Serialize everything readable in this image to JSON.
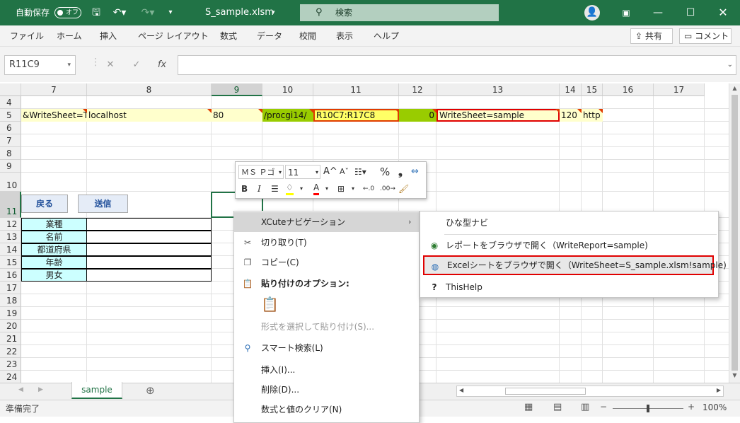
{
  "titlebar": {
    "autosave_label": "自動保存",
    "autosave_state": "オフ",
    "filename": "S_sample.xlsm",
    "search_placeholder": "検索"
  },
  "menu": {
    "items": [
      "ファイル",
      "ホーム",
      "挿入",
      "ページ レイアウト",
      "数式",
      "データ",
      "校閲",
      "表示",
      "ヘルプ"
    ],
    "share": "共有",
    "comment": "コメント"
  },
  "formula": {
    "namebox": "R11C9",
    "fx": "fx"
  },
  "columns": [
    {
      "label": "7"
    },
    {
      "label": "8"
    },
    {
      "label": "9"
    },
    {
      "label": "10"
    },
    {
      "label": "11"
    },
    {
      "label": "12"
    },
    {
      "label": "13"
    },
    {
      "label": "14"
    },
    {
      "label": "15"
    },
    {
      "label": "16"
    },
    {
      "label": "17"
    }
  ],
  "rows": [
    "4",
    "5",
    "6",
    "7",
    "8",
    "9",
    "10",
    "11",
    "12",
    "13",
    "14",
    "15",
    "16",
    "17",
    "18",
    "19",
    "20",
    "21",
    "22",
    "23",
    "24"
  ],
  "row5": {
    "c7": "&WriteSheet=T",
    "c8": "localhost",
    "c9": "80",
    "c10": "/procgi14/",
    "c11": "R10C7:R17C8",
    "c12": "0",
    "c13": "WriteSheet=sample",
    "c14": "120",
    "c15": "http"
  },
  "buttons": {
    "back": "戻る",
    "send": "送信"
  },
  "form_labels": [
    "業種",
    "名前",
    "都道府県",
    "年齢",
    "男女"
  ],
  "minitoolbar": {
    "font": "ＭＳ Ｐゴ",
    "size": "11",
    "bold": "B",
    "italic": "I",
    "percent": "%",
    "comma": "❟",
    "grow": "A^",
    "shrink": "Aˇ"
  },
  "context": {
    "xcute": "XCuteナビゲーション",
    "cut": "切り取り(T)",
    "copy": "コピー(C)",
    "paste_options": "貼り付けのオプション:",
    "paste_special": "形式を選択して貼り付け(S)...",
    "smart": "スマート検索(L)",
    "insert": "挿入(I)...",
    "delete": "削除(D)...",
    "clear": "数式と値のクリア(N)"
  },
  "submenu": {
    "hina": "ひな型ナビ",
    "report": "レポートをブラウザで開く（WriteReport=sample)",
    "sheet": "Excelシートをブラウザで開く（WriteSheet=S_sample.xlsm!sample)",
    "help": "ThisHelp"
  },
  "sheet_tab": "sample",
  "status": {
    "ready": "準備完了",
    "zoom": "100%"
  }
}
